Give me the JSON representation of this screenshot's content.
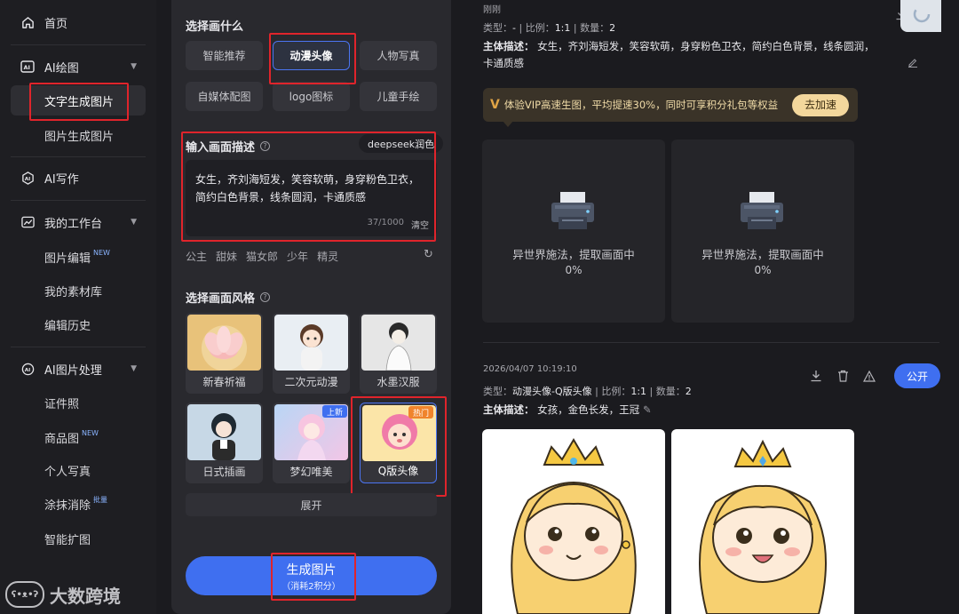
{
  "sidebar": {
    "home": "首页",
    "ai_draw": "AI绘图",
    "text_to_image": "文字生成图片",
    "image_to_image": "图片生成图片",
    "ai_writing": "AI写作",
    "workspace": "我的工作台",
    "image_edit": "图片编辑",
    "image_edit_badge": "NEW",
    "materials": "我的素材库",
    "edit_history": "编辑历史",
    "ai_image_processing": "AI图片处理",
    "id_photo": "证件照",
    "product_image": "商品图",
    "product_image_badge": "NEW",
    "portrait": "个人写真",
    "erase": "涂抹消除",
    "erase_badge": "批量",
    "smart_expand": "智能扩图",
    "watermark_text": "大数跨境"
  },
  "panel": {
    "choose_title": "选择画什么",
    "types": [
      "智能推荐",
      "动漫头像",
      "人物写真",
      "自媒体配图",
      "logo图标",
      "儿童手绘"
    ],
    "selected_type": "动漫头像",
    "desc_title": "输入画面描述",
    "deepseek_label": "deepseek润色",
    "desc_text": "女生，齐刘海短发，笑容软萌，身穿粉色卫衣，简约白色背景，线条圆润，卡通质感",
    "desc_count": "37/1000",
    "clear_label": "清空",
    "quick_tags": [
      "公主",
      "甜妹",
      "猫女郎",
      "少年",
      "精灵"
    ],
    "style_title": "选择画面风格",
    "styles": [
      {
        "name": "新春祈福",
        "badge": ""
      },
      {
        "name": "二次元动漫",
        "badge": ""
      },
      {
        "name": "水墨汉服",
        "badge": ""
      },
      {
        "name": "日式插画",
        "badge": ""
      },
      {
        "name": "梦幻唯美",
        "badge": "上新"
      },
      {
        "name": "Q版头像",
        "badge": "热门"
      }
    ],
    "expand_label": "展开",
    "generate_label": "生成图片",
    "generate_cost": "（消耗2积分）"
  },
  "current_task": {
    "time": "刚刚",
    "type_label": "类型：",
    "type_value": "-",
    "ratio_label": "比例：",
    "ratio_value": "1:1",
    "count_label": "数量：",
    "count_value": "2",
    "subject_label": "主体描述：",
    "subject_line1": "女生，齐刘海短发，笑容软萌，身穿粉色卫衣，简约白色背景，线条圆润，",
    "subject_line2": "卡通质感",
    "vip_text": "体验VIP高速生图，平均提速30%，同时可享积分礼包等权益",
    "vip_button": "去加速",
    "progress_msg": "异世界施法，提取画面中",
    "progress_pct": "0%"
  },
  "previous_task": {
    "time": "2026/04/07 10:19:10",
    "type_label": "类型：",
    "type_value": "动漫头像-Q版头像",
    "ratio_label": "比例：",
    "ratio_value": "1:1",
    "count_label": "数量：",
    "count_value": "2",
    "subject_label": "主体描述：",
    "subject_value": "女孩，金色长发，王冠",
    "public_button": "公开"
  },
  "colors": {
    "accent": "#3f6ff0",
    "highlight_box": "#e0242b",
    "vip_bg": "#3a3328",
    "vip_button": "#f3d79c"
  }
}
